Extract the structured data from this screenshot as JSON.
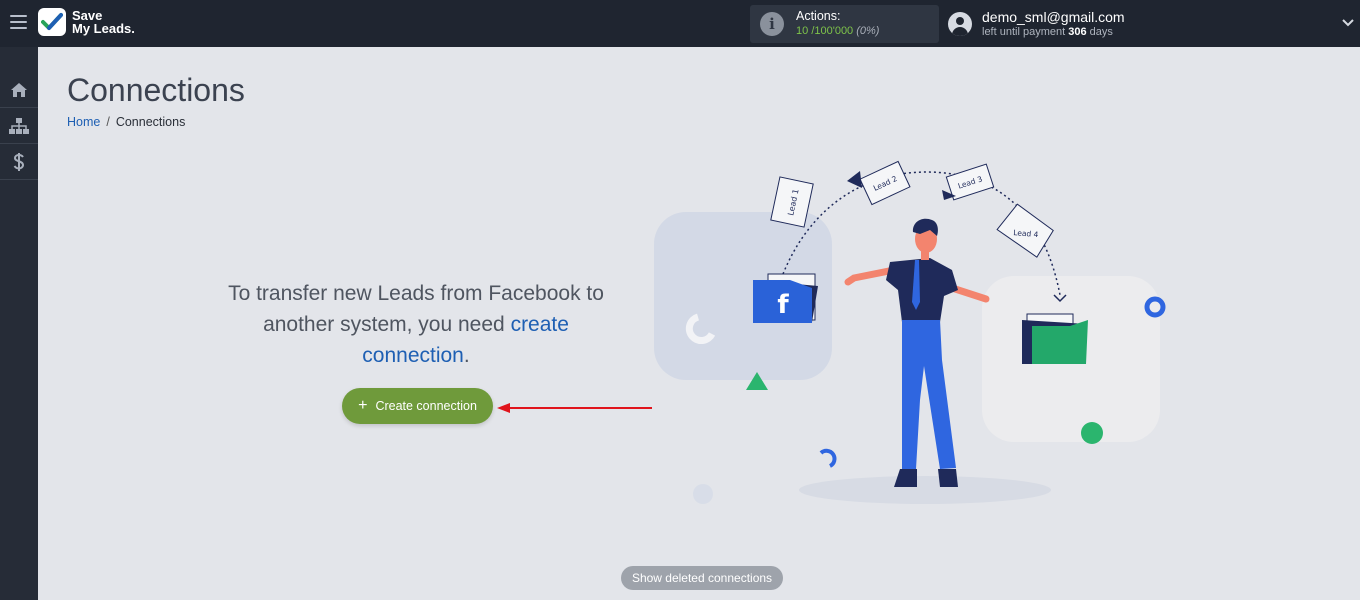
{
  "app": {
    "logo_line1": "Save",
    "logo_line2": "My Leads."
  },
  "header": {
    "actions_label": "Actions:",
    "actions_used": "10",
    "actions_total": "/100'000",
    "actions_percent": "(0%)",
    "user_email": "demo_sml@gmail.com",
    "days_prefix": "left until payment",
    "days_count": "306",
    "days_suffix": "days"
  },
  "sidebar": {
    "items": [
      {
        "icon": "home-icon"
      },
      {
        "icon": "sitemap-icon"
      },
      {
        "icon": "dollar-icon"
      }
    ]
  },
  "main": {
    "title": "Connections",
    "breadcrumb_home": "Home",
    "breadcrumb_separator": "/",
    "breadcrumb_current": "Connections",
    "message_part1": "To transfer new Leads from Facebook to another system, you need",
    "message_link": "create connection",
    "message_end": ".",
    "create_button": "Create connection",
    "show_deleted_button": "Show deleted connections"
  },
  "illustration": {
    "lead1": "Lead 1",
    "lead2": "Lead 2",
    "lead3": "Lead 3",
    "lead4": "Lead 4",
    "source_letter": "f"
  },
  "colors": {
    "topbar": "#1f2530",
    "sidebar": "#262c37",
    "background": "#e3e5ea",
    "primary_button": "#6f9a3b",
    "link": "#1e5fb3",
    "actions_value": "#7ec34a",
    "annotation_arrow": "#e0141c"
  }
}
